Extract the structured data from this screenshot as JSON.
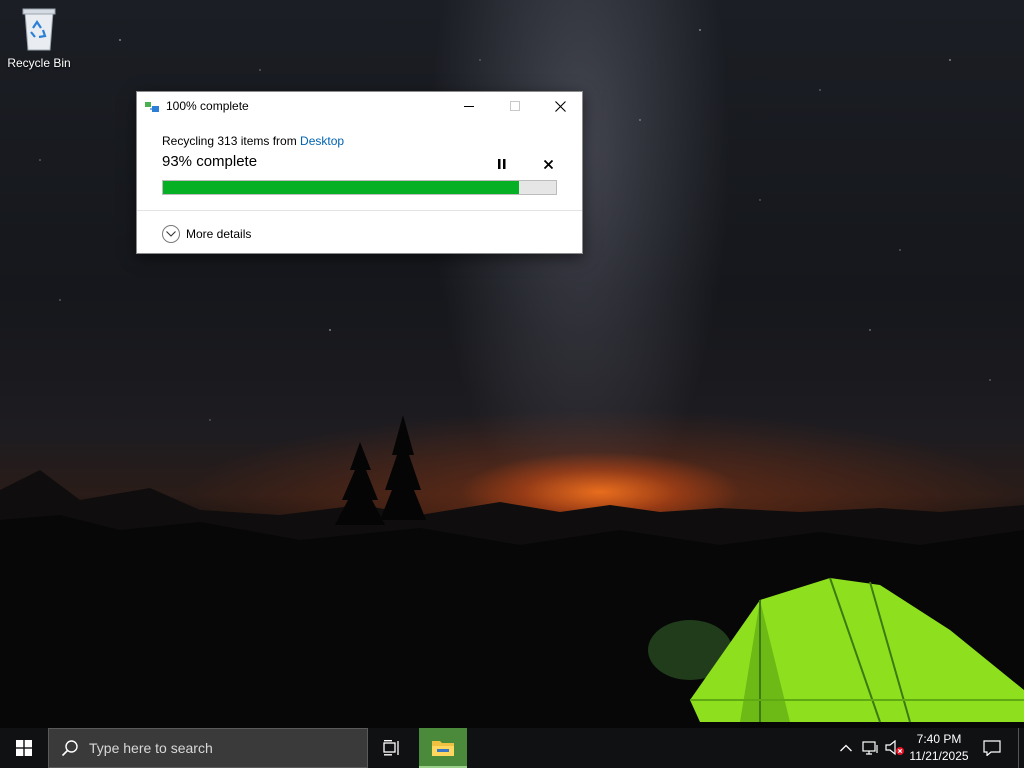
{
  "desktop": {
    "recycle_bin_label": "Recycle Bin"
  },
  "dialog": {
    "title": "100% complete",
    "description_prefix": "Recycling 313 items from ",
    "description_link": "Desktop",
    "percent_text": "93% complete",
    "progress_fraction": 0.905,
    "more_details_label": "More details",
    "colors": {
      "progress": "#06b025",
      "link": "#0063b1"
    }
  },
  "taskbar": {
    "search_placeholder": "Type here to search",
    "clock_time": "7:40 PM",
    "clock_date": "11/21/2025",
    "icons": {
      "start": "windows-logo-icon",
      "search": "search-icon",
      "task_view": "task-view-icon",
      "explorer": "file-explorer-icon",
      "tray_chevron": "chevron-up-icon",
      "network": "network-icon",
      "volume": "volume-muted-icon",
      "notifications": "notification-icon"
    }
  }
}
